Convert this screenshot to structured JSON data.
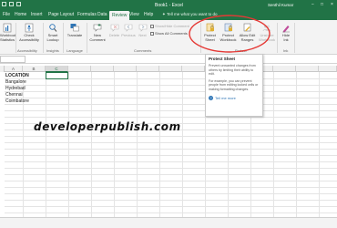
{
  "window": {
    "title": "Book1 - Excel",
    "user": "Senthil Kumar",
    "minimize": "−",
    "restore": "□",
    "close": "×"
  },
  "tabs": [
    "File",
    "Home",
    "Insert",
    "Page Layout",
    "Formulas",
    "Data",
    "Review",
    "View",
    "Help"
  ],
  "active_tab": "Review",
  "tell_me": "Tell me what you want to do",
  "ribbon": {
    "workbook_stats": "Workbook Statistics",
    "check_accessibility": "Check Accessibility",
    "accessibility_group": "Accessibility",
    "smart_lookup": "Smart Lookup",
    "insights_group": "Insights",
    "translate": "Translate",
    "language_group": "Language",
    "new_comment": "New Comment",
    "delete": "Delete",
    "previous": "Previous",
    "next": "Next",
    "show_hide_comment": "Show/Hide Comment",
    "show_all_comments": "Show All Comments",
    "comments_group": "Comments",
    "protect_sheet": "Protect Sheet",
    "protect_workbook": "Protect Workbook",
    "allow_edit_ranges": "Allow Edit Ranges",
    "unshare_workbook": "Unshare Workbook",
    "protect_group": "Protect",
    "hide_ink": "Hide Ink",
    "ink_group": "Ink"
  },
  "tooltip": {
    "title": "Protect Sheet",
    "p1": "Prevent unwanted changes from others by limiting their ability to edit.",
    "p2": "For example, you can prevent people from editing locked cells or making formatting changes.",
    "link": "Tell me more"
  },
  "grid": {
    "selected_column": "C",
    "rows": [
      {
        "text": "LOCATION",
        "bold": true
      },
      {
        "text": "Bangalore",
        "bold": false
      },
      {
        "text": "Hydrebad",
        "bold": false
      },
      {
        "text": "Chennai",
        "bold": false
      },
      {
        "text": "Coimbatore",
        "bold": false
      }
    ]
  },
  "watermark": "developerpublish.com",
  "colors": {
    "excel_green": "#217346",
    "highlight_circle": "#e53935",
    "link_blue": "#2e75b6"
  }
}
